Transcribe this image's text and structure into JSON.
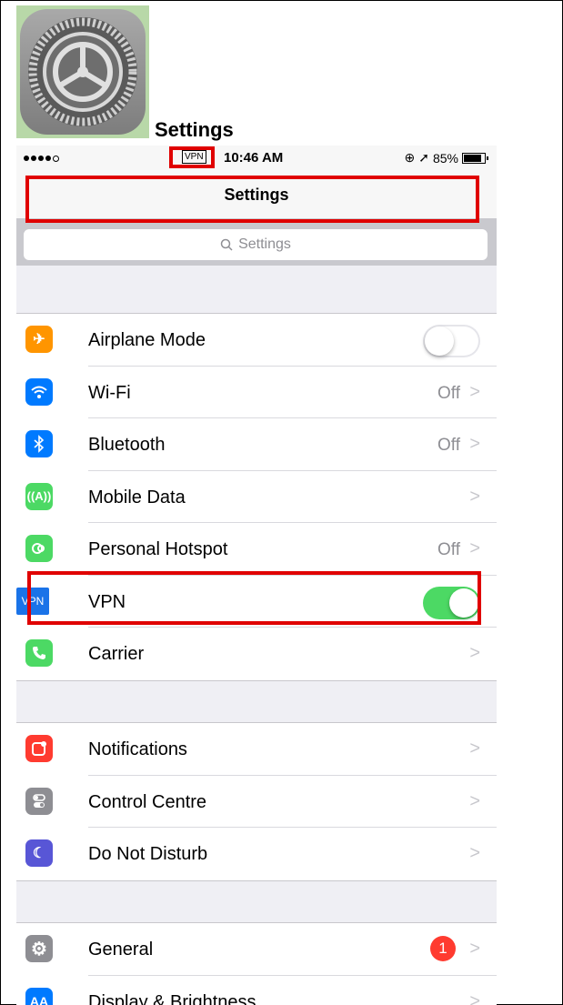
{
  "app_icon": {
    "caption": "Settings"
  },
  "status_bar": {
    "vpn_indicator": "VPN",
    "time": "10:46 AM",
    "battery": "85%",
    "battery_level": 0.85
  },
  "nav": {
    "title": "Settings"
  },
  "search": {
    "placeholder": "Settings"
  },
  "section1": [
    {
      "label": "Airplane Mode",
      "icon": "airplane-icon",
      "color": "#ff9500",
      "control": "toggle",
      "on": false
    },
    {
      "label": "Wi-Fi",
      "icon": "wifi-icon",
      "color": "#007aff",
      "value": "Off"
    },
    {
      "label": "Bluetooth",
      "icon": "bluetooth-icon",
      "color": "#007aff",
      "value": "Off"
    },
    {
      "label": "Mobile Data",
      "icon": "antenna-icon",
      "color": "#4cd964",
      "value": ""
    },
    {
      "label": "Personal Hotspot",
      "icon": "hotspot-icon",
      "color": "#4cd964",
      "value": "Off"
    },
    {
      "label": "VPN",
      "icon": "vpn-icon",
      "icon_text": "VPN",
      "color": "#1a73e8",
      "control": "toggle",
      "on": true
    },
    {
      "label": "Carrier",
      "icon": "phone-icon",
      "color": "#4cd964",
      "value": ""
    }
  ],
  "section2": [
    {
      "label": "Notifications",
      "icon": "notifications-icon",
      "color": "#ff3b30"
    },
    {
      "label": "Control Centre",
      "icon": "control-centre-icon",
      "color": "#8e8e93"
    },
    {
      "label": "Do Not Disturb",
      "icon": "moon-icon",
      "color": "#5856d6"
    }
  ],
  "section3": [
    {
      "label": "General",
      "icon": "gear-icon",
      "color": "#8e8e93",
      "badge": "1"
    },
    {
      "label": "Display & Brightness",
      "icon": "display-icon",
      "icon_text": "AA",
      "color": "#007aff"
    }
  ],
  "highlight_color": "#e00000"
}
